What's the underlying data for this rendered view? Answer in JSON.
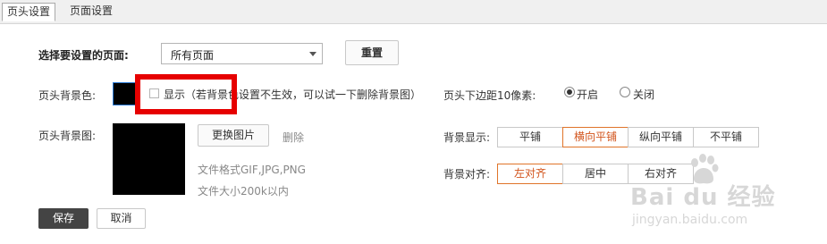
{
  "tabs": [
    {
      "label": "页头设置",
      "active": true
    },
    {
      "label": "页面设置",
      "active": false
    }
  ],
  "page_select": {
    "label": "选择要设置的页面:",
    "value": "所有页面",
    "reset_label": "重置"
  },
  "header_bg_color": {
    "label": "页头背景色:",
    "show_label": "显示（若背景色设置不生效，可以试一下删除背景图）",
    "checked": false
  },
  "header_margin": {
    "label": "页头下边距10像素:",
    "options": [
      {
        "label": "开启",
        "selected": true
      },
      {
        "label": "关闭",
        "selected": false
      }
    ]
  },
  "header_bg_image": {
    "label": "页头背景图:",
    "change_label": "更换图片",
    "delete_label": "删除",
    "format_note": "文件格式GIF,JPG,PNG",
    "size_note": "文件大小200k以内"
  },
  "bg_display": {
    "label": "背景显示:",
    "options": [
      "平铺",
      "横向平铺",
      "纵向平铺",
      "不平铺"
    ],
    "selected": "横向平铺"
  },
  "bg_align": {
    "label": "背景对齐:",
    "options": [
      "左对齐",
      "居中",
      "右对齐"
    ],
    "selected": "左对齐"
  },
  "actions": {
    "save_label": "保存",
    "cancel_label": "取消"
  },
  "watermark": {
    "brand": "Bai du 经验",
    "url": "jingyan.baidu.com"
  },
  "colors": {
    "highlight": "#e60000",
    "selected_accent": "#d2541c"
  }
}
